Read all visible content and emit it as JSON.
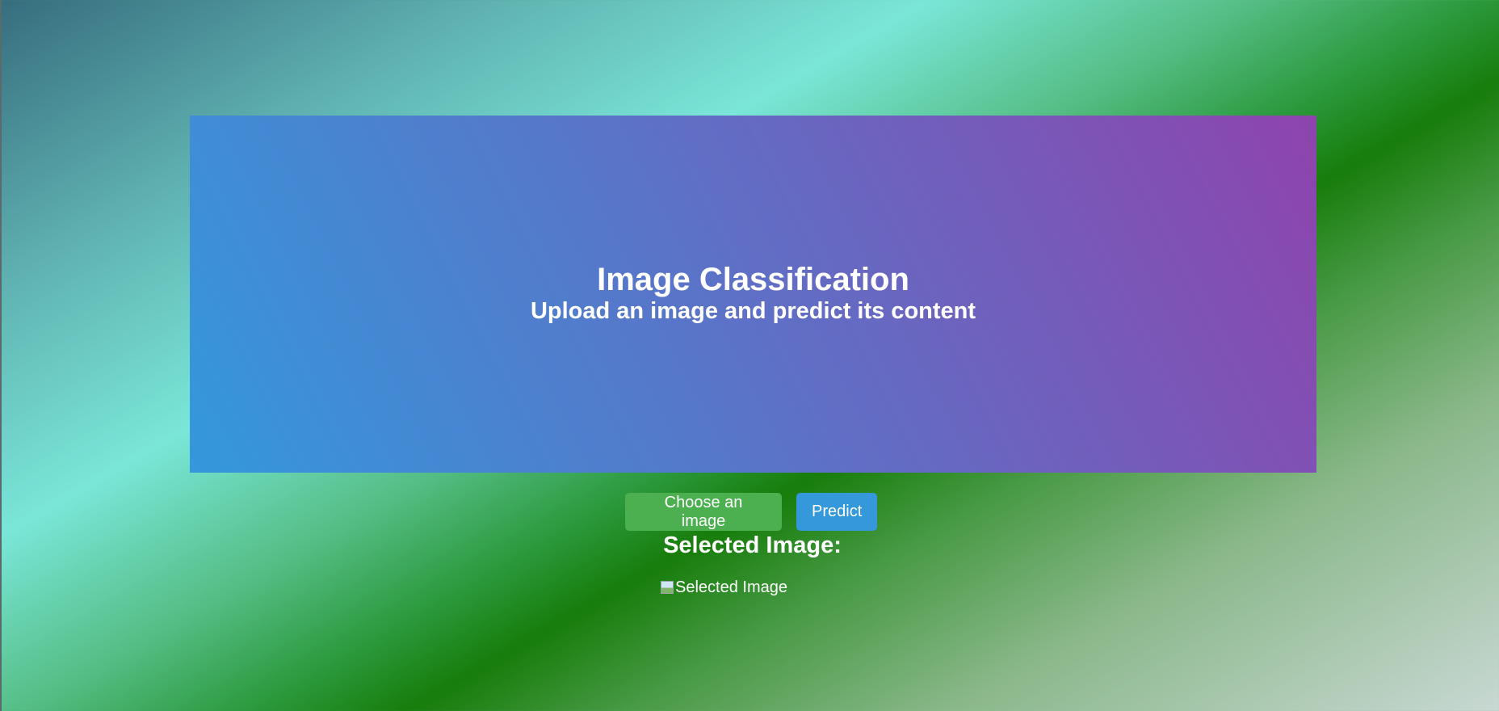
{
  "hero": {
    "title": "Image Classification",
    "subtitle": "Upload an image and predict its content"
  },
  "controls": {
    "choose_label": "Choose an image",
    "predict_label": "Predict"
  },
  "selected": {
    "heading": "Selected Image:",
    "image_alt": "Selected Image"
  },
  "colors": {
    "choose_button": "#4caf50",
    "predict_button": "#3498db",
    "hero_gradient_start": "#3498db",
    "hero_gradient_end": "#8e44ad"
  },
  "icons": {
    "broken_image": "broken-image-icon"
  }
}
